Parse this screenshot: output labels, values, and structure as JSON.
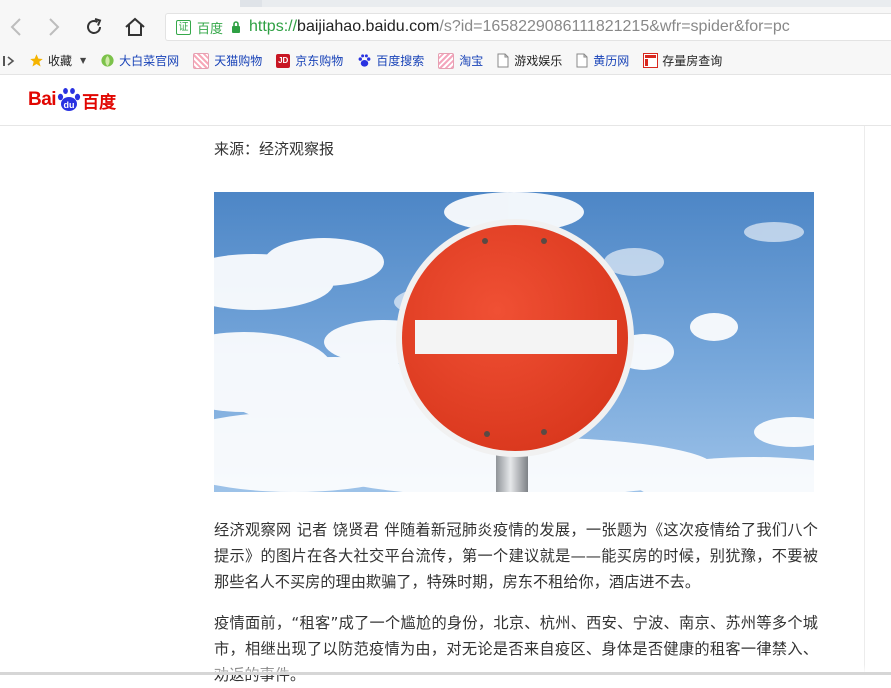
{
  "browser": {
    "address": {
      "cert_label": "证",
      "cert_name": "百度",
      "url_scheme": "https://",
      "url_host": "baijiahao.baidu.com",
      "url_path": "/s?id=1658229086111821215&wfr=spider&for=pc"
    },
    "nav_icons": [
      "back-icon",
      "forward-icon",
      "reload-icon",
      "home-icon"
    ],
    "bookmarks": [
      {
        "label": "收藏",
        "icon": "star-icon"
      },
      {
        "label": "大白菜官网",
        "icon": "cabbage-icon"
      },
      {
        "label": "天猫购物",
        "icon": "tmall-icon"
      },
      {
        "label": "京东购物",
        "icon": "jd-icon"
      },
      {
        "label": "百度搜索",
        "icon": "baidu-paw-icon"
      },
      {
        "label": "淘宝",
        "icon": "taobao-icon"
      },
      {
        "label": "游戏娱乐",
        "icon": "page-icon"
      },
      {
        "label": "黄历网",
        "icon": "page-icon"
      },
      {
        "label": "存量房查询",
        "icon": "red-square-icon"
      }
    ]
  },
  "site": {
    "logo_left": "Bai",
    "logo_right": "百度"
  },
  "article": {
    "source": "来源：经济观察报",
    "image_icon": "no-entry-sign",
    "paragraphs": [
      "经济观察网 记者 饶贤君 伴随着新冠肺炎疫情的发展，一张题为《这次疫情给了我们八个提示》的图片在各大社交平台流传，第一个建议就是——能买房的时候，别犹豫，不要被那些名人不买房的理由欺骗了，特殊时期，房东不租给你，酒店进不去。",
      "疫情面前，“租客”成了一个尴尬的身份，北京、杭州、西安、宁波、南京、苏州等多个城市，相继出现了以防范疫情为由，对无论是否来自疫区、身体是否健康的租客一律禁入、劝返的事件。"
    ]
  },
  "colors": {
    "baidu_red": "#e10601",
    "baidu_blue": "#2932e1",
    "secure_green": "#2ea043",
    "sign_red": "#e43d22"
  }
}
